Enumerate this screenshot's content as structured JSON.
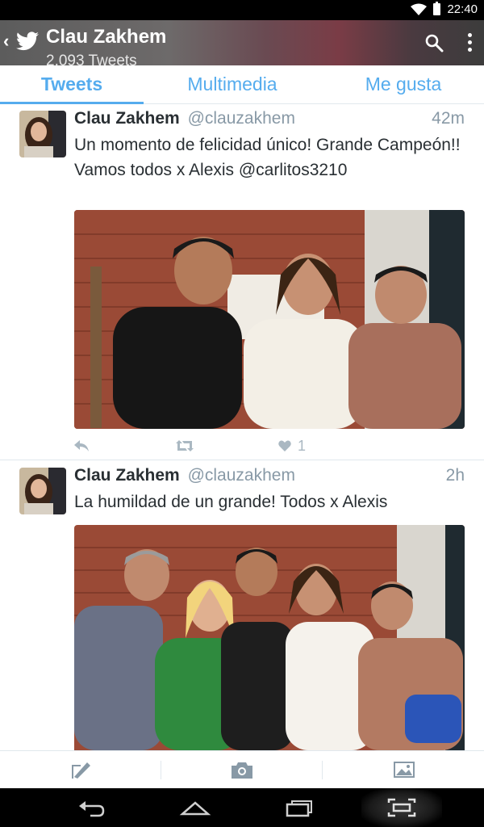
{
  "status_bar": {
    "time": "22:40",
    "icons": [
      "wifi-icon",
      "battery-icon"
    ]
  },
  "header": {
    "title": "Clau Zakhem",
    "subtitle": "2.093 Tweets",
    "icons": [
      "back-icon",
      "twitter-bird-icon",
      "search-icon",
      "overflow-menu-icon"
    ]
  },
  "tabs": [
    {
      "label": "Tweets",
      "active": true
    },
    {
      "label": "Multimedia",
      "active": false
    },
    {
      "label": "Me gusta",
      "active": false
    }
  ],
  "tweets": [
    {
      "name": "Clau Zakhem",
      "handle": "@clauzakhem",
      "time": "42m",
      "text": "Un momento de felicidad único! Grande Campeón!! Vamos todos x Alexis @carlitos3210",
      "like_count": "1"
    },
    {
      "name": "Clau Zakhem",
      "handle": "@clauzakhem",
      "time": "2h",
      "text": "La humildad de un grande! Todos x Alexis"
    }
  ],
  "compose_bar": {
    "icons": [
      "compose-icon",
      "camera-icon",
      "gallery-icon"
    ]
  },
  "nav_bar": {
    "icons": [
      "back-nav-icon",
      "home-nav-icon",
      "recents-nav-icon",
      "screenshot-nav-icon"
    ]
  },
  "colors": {
    "accent": "#55acee",
    "text": "#292f33",
    "muted": "#8899a6",
    "divider": "#e1e8ed"
  }
}
